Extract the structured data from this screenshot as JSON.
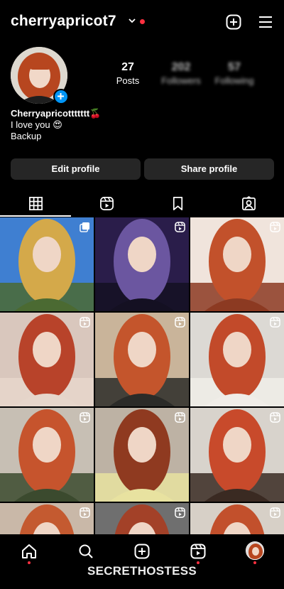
{
  "header": {
    "username": "cherryapricot7",
    "has_live_indicator": true,
    "icons": [
      "chevron-down-icon",
      "plus-square-icon",
      "hamburger-menu-icon"
    ]
  },
  "profile": {
    "display_name": "Cherryapricottttttt🍒",
    "bio_lines": [
      "I love you 😍",
      "Backup"
    ],
    "stats": {
      "posts_count": "27",
      "posts_label": "Posts",
      "followers_count": "202",
      "followers_label": "Followers",
      "following_count": "57",
      "following_label": "Following"
    },
    "edit_button": "Edit profile",
    "share_button": "Share profile"
  },
  "tabs": [
    {
      "icon": "grid-icon",
      "active": true
    },
    {
      "icon": "reels-icon",
      "active": false
    },
    {
      "icon": "saved-icon",
      "active": false
    },
    {
      "icon": "tagged-icon",
      "active": false
    }
  ],
  "grid": {
    "columns": 3,
    "posts": [
      {
        "type": "carousel",
        "palette": [
          "#3f7fd1",
          "#d4a94a",
          "#4b6a32"
        ]
      },
      {
        "type": "reel",
        "palette": [
          "#2a1d4a",
          "#6b56a0",
          "#141022"
        ]
      },
      {
        "type": "reel",
        "palette": [
          "#f0e4dc",
          "#c2512b",
          "#8c3a22"
        ]
      },
      {
        "type": "reel",
        "palette": [
          "#d9c7bd",
          "#b8432a",
          "#e6d6cb"
        ]
      },
      {
        "type": "reel",
        "palette": [
          "#c9b49a",
          "#c4552c",
          "#2b2b28"
        ]
      },
      {
        "type": "reel",
        "palette": [
          "#dcd9d4",
          "#c24a2a",
          "#f0ede8"
        ]
      },
      {
        "type": "reel",
        "palette": [
          "#c7bfb4",
          "#c6542d",
          "#3b4a2e"
        ]
      },
      {
        "type": "reel",
        "palette": [
          "#bdb2a4",
          "#8f3a20",
          "#e8e2a0"
        ]
      },
      {
        "type": "reel",
        "palette": [
          "#d8d3cc",
          "#c84a2b",
          "#3a2a22"
        ]
      },
      {
        "type": "reel",
        "palette": [
          "#c9b8a8",
          "#c45a30",
          "#e2d2c6"
        ]
      },
      {
        "type": "reel",
        "palette": [
          "#6f6f6f",
          "#a34128",
          "#d7c6bb"
        ]
      },
      {
        "type": "reel",
        "palette": [
          "#d7d0c7",
          "#c2502c",
          "#e6d7cc"
        ]
      }
    ]
  },
  "bottom_nav": {
    "items": [
      "home-icon",
      "search-icon",
      "create-icon",
      "reels-icon",
      "profile-avatar"
    ],
    "notification_dot_color": "#ff3040"
  },
  "watermark": "SECRETHOSTESS",
  "colors": {
    "accent_blue": "#0095f6",
    "button_bg": "#262626",
    "background": "#000000",
    "live_red": "#ff3040"
  }
}
